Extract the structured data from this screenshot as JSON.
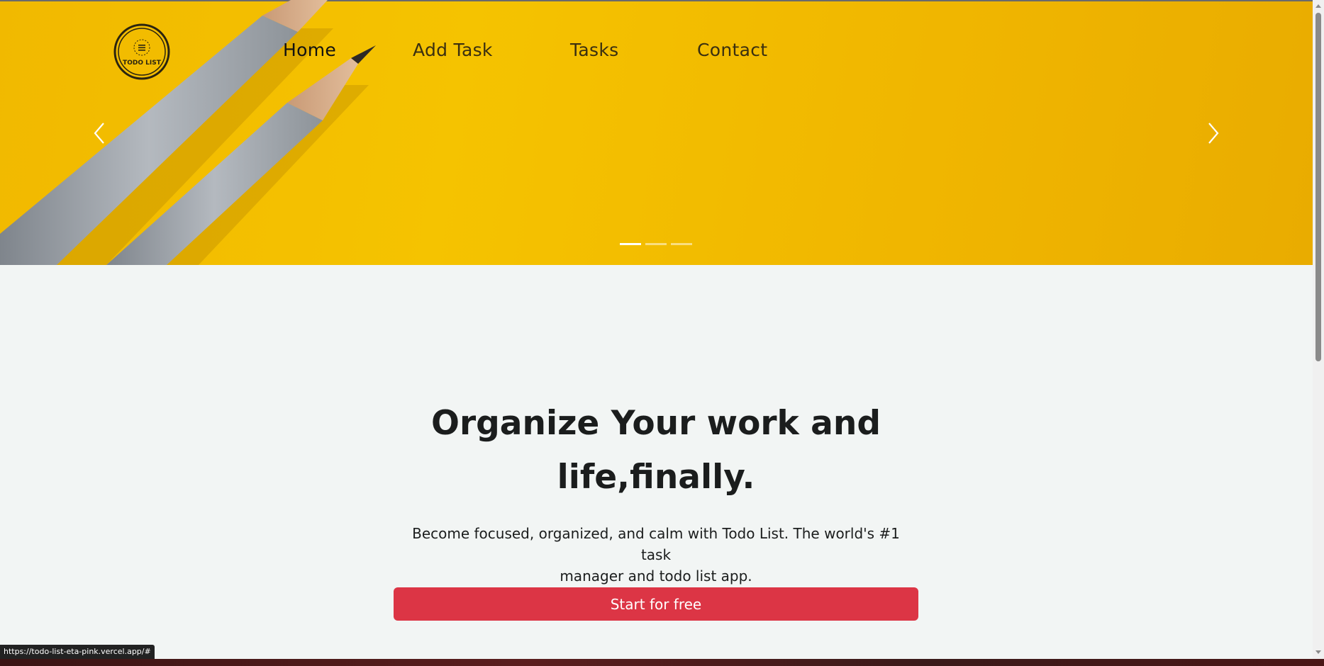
{
  "nav": {
    "logo_text": "TODO LIST",
    "links": [
      {
        "label": "Home",
        "active": true
      },
      {
        "label": "Add Task",
        "active": false
      },
      {
        "label": "Tasks",
        "active": false
      },
      {
        "label": "Contact",
        "active": false
      }
    ]
  },
  "carousel": {
    "slide_count": 3,
    "active_slide": 1
  },
  "hero": {
    "headline_line1": "Organize Your work and",
    "headline_line2": "life,finally.",
    "subtext_line1": "Become focused, organized, and calm with Todo List. The world's #1 task",
    "subtext_line2": "manager and todo list app.",
    "cta_label": "Start for free"
  },
  "status_bar": {
    "url": "https://todo-list-eta-pink.vercel.app/#"
  },
  "colors": {
    "hero_yellow": "#f5c300",
    "cta_red": "#dc3545",
    "page_bg": "#f2f5f4",
    "text_dark": "#1b1d1d"
  }
}
